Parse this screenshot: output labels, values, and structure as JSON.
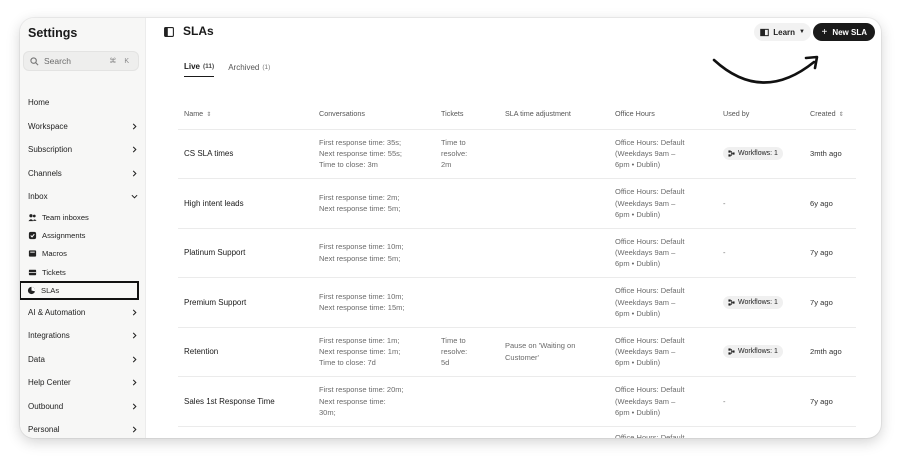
{
  "sidebar": {
    "title": "Settings",
    "search": {
      "placeholder": "Search",
      "shortcut": "⌘ K"
    },
    "items": [
      {
        "label": "Home",
        "chevron": false
      },
      {
        "label": "Workspace",
        "chevron": true
      },
      {
        "label": "Subscription",
        "chevron": true
      },
      {
        "label": "Channels",
        "chevron": true
      },
      {
        "label": "Inbox",
        "chevron": true,
        "expanded": true
      }
    ],
    "inbox_sub": [
      {
        "label": "Team inboxes",
        "icon": "team-icon"
      },
      {
        "label": "Assignments",
        "icon": "assignments-icon"
      },
      {
        "label": "Macros",
        "icon": "macros-icon"
      },
      {
        "label": "Tickets",
        "icon": "tickets-icon"
      },
      {
        "label": "SLAs",
        "icon": "sla-icon",
        "active": true
      }
    ],
    "items_after": [
      {
        "label": "AI & Automation"
      },
      {
        "label": "Integrations"
      },
      {
        "label": "Data"
      },
      {
        "label": "Help Center"
      },
      {
        "label": "Outbound"
      },
      {
        "label": "Personal"
      }
    ]
  },
  "header": {
    "title": "SLAs",
    "learn_label": "Learn",
    "new_label": "New SLA"
  },
  "tabs": [
    {
      "label": "Live",
      "count": "(11)",
      "active": true
    },
    {
      "label": "Archived",
      "count": "(1)",
      "active": false
    }
  ],
  "table": {
    "columns": [
      "Name",
      "Conversations",
      "Tickets",
      "SLA time adjustment",
      "Office Hours",
      "Used by",
      "Created"
    ],
    "rows": [
      {
        "name": "CS SLA times",
        "conversations": "First response time: 35s;\nNext response time: 55s;\nTime to close: 3m",
        "tickets": "Time to\nresolve:\n2m",
        "adjustment": "",
        "office_hours": "Office Hours: Default\n(Weekdays 9am –\n6pm • Dublin)",
        "used_by": "Workflows: 1",
        "created": "3mth ago"
      },
      {
        "name": "High intent leads",
        "conversations": "First response time: 2m;\nNext response time: 5m;",
        "tickets": "",
        "adjustment": "",
        "office_hours": "Office Hours: Default\n(Weekdays 9am –\n6pm • Dublin)",
        "used_by": "-",
        "created": "6y ago"
      },
      {
        "name": "Platinum Support",
        "conversations": "First response time: 10m;\nNext response time: 5m;",
        "tickets": "",
        "adjustment": "",
        "office_hours": "Office Hours: Default\n(Weekdays 9am –\n6pm • Dublin)",
        "used_by": "-",
        "created": "7y ago"
      },
      {
        "name": "Premium Support",
        "conversations": "First response time: 10m;\nNext response time: 15m;",
        "tickets": "",
        "adjustment": "",
        "office_hours": "Office Hours: Default\n(Weekdays 9am –\n6pm • Dublin)",
        "used_by": "Workflows: 1",
        "created": "7y ago"
      },
      {
        "name": "Retention",
        "conversations": "First response time: 1m;\nNext response time: 1m;\nTime to close: 7d",
        "tickets": "Time to\nresolve:\n5d",
        "adjustment": "Pause on 'Waiting on\nCustomer'",
        "office_hours": "Office Hours: Default\n(Weekdays 9am –\n6pm • Dublin)",
        "used_by": "Workflows: 1",
        "created": "2mth ago"
      },
      {
        "name": "Sales 1st Response Time",
        "conversations": "First response time: 20m;\nNext response time:\n30m;",
        "tickets": "",
        "adjustment": "",
        "office_hours": "Office Hours: Default\n(Weekdays 9am –\n6pm • Dublin)",
        "used_by": "-",
        "created": "7y ago"
      }
    ],
    "partial_row_office_hours": "Office Hours: Default"
  }
}
